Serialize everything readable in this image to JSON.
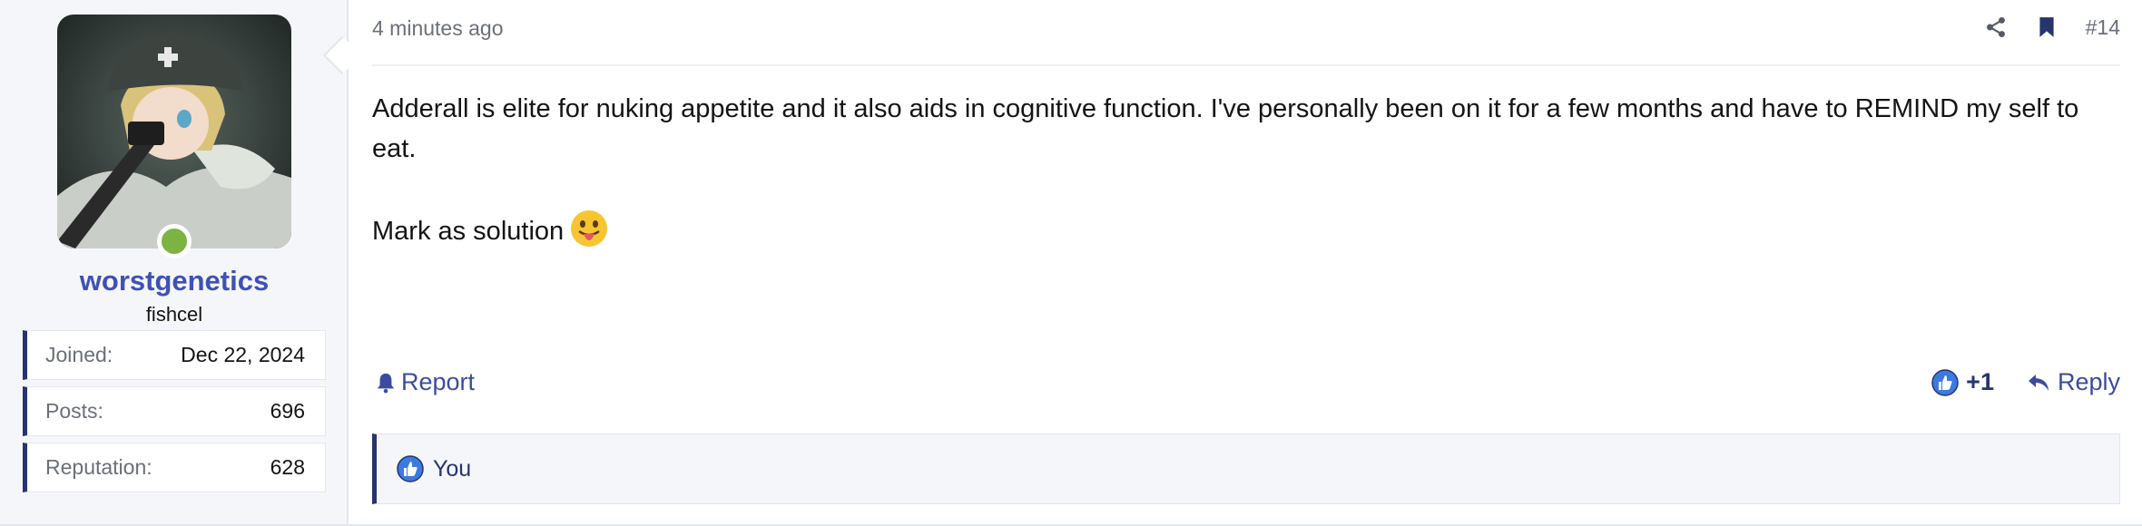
{
  "user": {
    "username": "worstgenetics",
    "title": "fishcel",
    "online": true,
    "stats": [
      {
        "label": "Joined:",
        "value": "Dec 22, 2024"
      },
      {
        "label": "Posts:",
        "value": "696"
      },
      {
        "label": "Reputation:",
        "value": "628"
      }
    ]
  },
  "post": {
    "timestamp": "4 minutes ago",
    "number": "#14",
    "paragraph1": "Adderall is elite for nuking appetite and it also aids in cognitive function. I've personally been on it for a few months and have to REMIND my self to eat.",
    "paragraph2": "Mark as solution"
  },
  "actions": {
    "report_label": "Report",
    "reaction_count": "+1",
    "reply_label": "Reply"
  },
  "reactions": {
    "reactors": "You"
  },
  "icons": {
    "header": [
      "share-icon",
      "bookmark-icon"
    ],
    "emoji": "tongue-out-emoji",
    "report": "bell-icon",
    "like": "thumbs-up-icon",
    "reply": "reply-arrow-icon"
  },
  "colors": {
    "username": "#3f51b5",
    "accent_bar": "#27346e",
    "link": "#3b4c9e",
    "online": "#7cb342",
    "sidebar_bg": "#f5f6f9"
  }
}
